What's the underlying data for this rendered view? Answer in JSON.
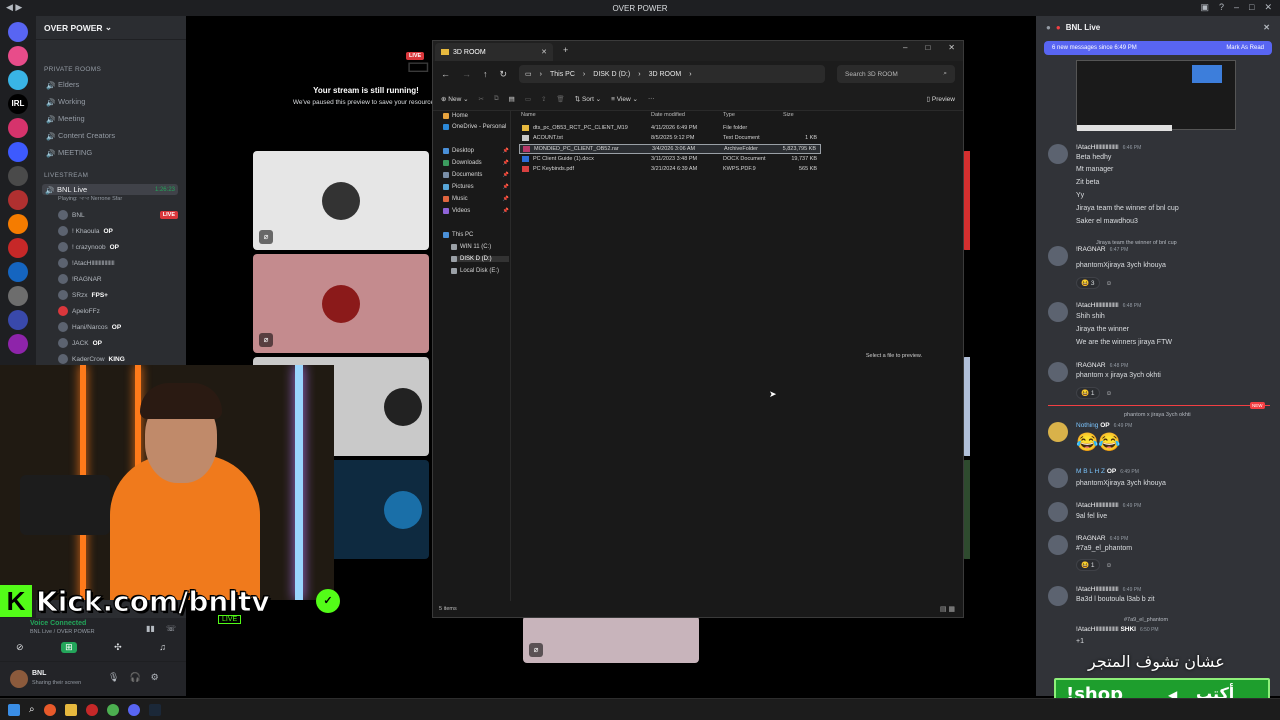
{
  "app_title": "OVER POWER",
  "server": {
    "name": "OVER POWER"
  },
  "server_badges": {
    "top": "1K+"
  },
  "sidebar": {
    "categories": {
      "private": "PRIVATE ROOMS",
      "livestream": "LIVESTREAM"
    },
    "channels": [
      {
        "label": "Elders"
      },
      {
        "label": "Working"
      },
      {
        "label": "Meeting"
      },
      {
        "label": "Content Creators"
      },
      {
        "label": "MEETING"
      }
    ],
    "live_channel": {
      "label": "BNL Live",
      "timer": "1:26:23",
      "activity": "Playing: ~r~r Nerrone Sfar"
    },
    "voice_users": [
      {
        "name": "BNL",
        "badge": "LIVE"
      },
      {
        "name": "! Khaoula",
        "tag": "OP"
      },
      {
        "name": "! crazynoob",
        "tag": "OP"
      },
      {
        "name": "!AtacHllllllllllllllll"
      },
      {
        "name": "!RAGNAR"
      },
      {
        "name": "SRzx",
        "tag": "FPS+"
      },
      {
        "name": "ApeloFFz"
      },
      {
        "name": "Hani/Narcos",
        "tag": "OP"
      },
      {
        "name": "JACK",
        "tag": "OP"
      },
      {
        "name": "KaderCrow",
        "tag": "KING"
      }
    ]
  },
  "voice_panel": {
    "status": "Voice Connected",
    "channel": "BNL Live / OVER POWER"
  },
  "user_panel": {
    "name": "BNL",
    "status": "Sharing their screen"
  },
  "stage": {
    "live_badge": "LIVE",
    "paused_title": "Your stream is still running!",
    "paused_sub": "We've paused this preview to save your resources."
  },
  "overlay": {
    "kick_url": "Kick.com/bnltv",
    "kick_live": "LIVE"
  },
  "explorer": {
    "tab_title": "3D ROOM",
    "breadcrumb": [
      "This PC",
      "DISK D (D:)",
      "3D ROOM"
    ],
    "search_placeholder": "Search 3D ROOM",
    "toolbar": {
      "new": "New",
      "sort": "Sort",
      "view": "View",
      "preview": "Preview"
    },
    "nav": [
      {
        "label": "Home",
        "color": "#e7a33e"
      },
      {
        "label": "OneDrive - Personal",
        "color": "#2b88d8"
      },
      {
        "label": "Desktop",
        "color": "#4a90d9",
        "pinned": true
      },
      {
        "label": "Downloads",
        "color": "#3c9c5f",
        "pinned": true
      },
      {
        "label": "Documents",
        "color": "#7a8fa8",
        "pinned": true
      },
      {
        "label": "Pictures",
        "color": "#58a6d8",
        "pinned": true
      },
      {
        "label": "Music",
        "color": "#e0653f",
        "pinned": true
      },
      {
        "label": "Videos",
        "color": "#8f63d8",
        "pinned": true
      },
      {
        "label": "This PC",
        "color": "#4a90d9"
      },
      {
        "label": "WIN 11  (C:)",
        "color": "#9aa0a6"
      },
      {
        "label": "DISK D (D:)",
        "color": "#9aa0a6"
      },
      {
        "label": "Local Disk (E:)",
        "color": "#9aa0a6"
      }
    ],
    "columns": {
      "name": "Name",
      "date": "Date modified",
      "type": "Type",
      "size": "Size"
    },
    "files": [
      {
        "name": "dts_pc_OB53_RCT_PC_CLIENT_M19",
        "date": "4/11/2026 6:49 PM",
        "type": "File folder",
        "size": "",
        "icon": "#e7b93e"
      },
      {
        "name": "ACOUNT.txt",
        "date": "8/5/2025 9:12 PM",
        "type": "Text Document",
        "size": "1 KB",
        "icon": "#c8c8c8"
      },
      {
        "name": "MONDIED_PC_CLIENT_OB52.rar",
        "date": "3/4/2026 3:06 AM",
        "type": "ArchiveFolder",
        "size": "5,823,795 KB",
        "icon": "#b8386a"
      },
      {
        "name": "PC Client Guide (1).docx",
        "date": "3/11/2023 3:48 PM",
        "type": "DOCX Document",
        "size": "19,737 KB",
        "icon": "#2b6cd8"
      },
      {
        "name": "PC Keybinds.pdf",
        "date": "3/21/2024 6:39 AM",
        "type": "KWPS.PDF.9",
        "size": "565 KB",
        "icon": "#d84040"
      }
    ],
    "preview_hint": "Select a file to preview.",
    "status": "5 items"
  },
  "chat": {
    "title": "BNL Live",
    "new_messages": "6 new messages since 6:49 PM",
    "mark_read": "Mark As Read",
    "messages": [
      {
        "author": "!AtacHllllllllllllllll",
        "time": "6:46 PM",
        "lines": [
          "Beta hedhy",
          "Mt manager",
          "Zit beta",
          "Yy",
          "Jiraya team the winner of bnl cup",
          "Saker el mawdhou3"
        ]
      },
      {
        "author": "!RAGNAR",
        "time": "6:47 PM",
        "reply": "Jiraya team the winner of bnl cup",
        "lines": [
          "phantomXjiraya 3ych khouya"
        ],
        "react": "😆 3"
      },
      {
        "author": "!AtacHllllllllllllllll",
        "time": "6:48 PM",
        "lines": [
          "Shih shih",
          "Jiraya the winner",
          "We are the winners jiraya FTW"
        ]
      },
      {
        "author": "!RAGNAR",
        "time": "6:48 PM",
        "lines": [
          "phantom x jiraya 3ych okhti"
        ],
        "react": "😆 1"
      },
      {
        "author": "Nothing",
        "time": "6:49 PM",
        "reply": "phantom x jiraya 3ych okhti",
        "lines": [
          "😂😂"
        ],
        "tag": "OP"
      },
      {
        "author": "M B L H Z",
        "time": "6:49 PM",
        "lines": [
          "phantomXjiraya 3ych khouya"
        ],
        "tag": "OP"
      },
      {
        "author": "!AtacHllllllllllllllll",
        "time": "6:49 PM",
        "lines": [
          "9al fel live"
        ]
      },
      {
        "author": "!RAGNAR",
        "time": "6:49 PM",
        "lines": [
          "#7a9_el_phantom"
        ],
        "react": "😆 1"
      },
      {
        "author": "!AtacHllllllllllllllll",
        "time": "6:49 PM",
        "lines": [
          "Ba3d l boutoula l3ab b zit"
        ]
      },
      {
        "author": "!AtacHllllllllllllllll",
        "time": "6:50 PM",
        "reply": "#7a9_el_phantom",
        "lines": [
          "+1"
        ],
        "tag": "SHKI"
      }
    ],
    "new_tag": "NEW"
  },
  "shop_overlay": {
    "arabic_top": "عشان تشوف المتجر",
    "arabic_cmd": "أكتب",
    "command": "!shop"
  },
  "colors": {
    "discord_bg": "#313338",
    "sidebar_bg": "#2b2d31",
    "accent": "#5865f2",
    "live": "#da373c",
    "kick_green": "#53fc18"
  }
}
